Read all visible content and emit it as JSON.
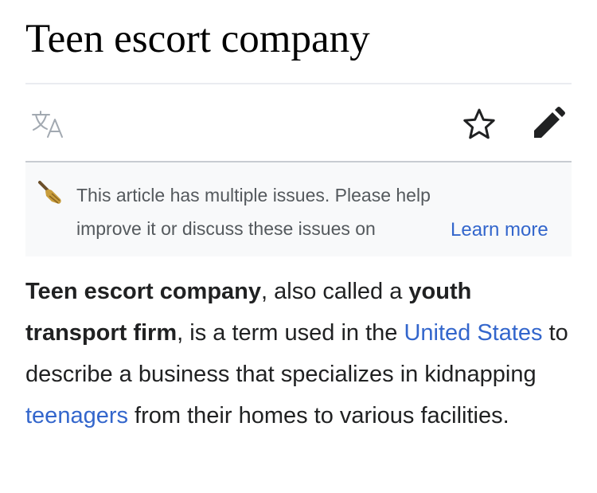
{
  "article": {
    "title": "Teen escort company"
  },
  "actions": {
    "language_icon": "translate-icon",
    "watch_icon": "star-icon",
    "edit_icon": "pencil-icon"
  },
  "issues_notice": {
    "icon": "broom-icon",
    "line1": "This article has multiple issues. Please help",
    "line2": "improve it or discuss these issues on",
    "learn_more": "Learn more"
  },
  "lead": {
    "term1": "Teen escort company",
    "text1": ", also called a ",
    "term2": "youth transport firm",
    "text2": ", is a term used in the ",
    "link1": "United States",
    "text3": " to describe a business that specializes in kidnapping ",
    "link2": "teenagers",
    "text4": " from their homes to various facilities."
  },
  "colors": {
    "link": "#3366cc",
    "body_text": "#202122",
    "muted_icon": "#a2a9b1",
    "notice_bg": "#f8f9fa",
    "broom": "#c89d3c"
  }
}
